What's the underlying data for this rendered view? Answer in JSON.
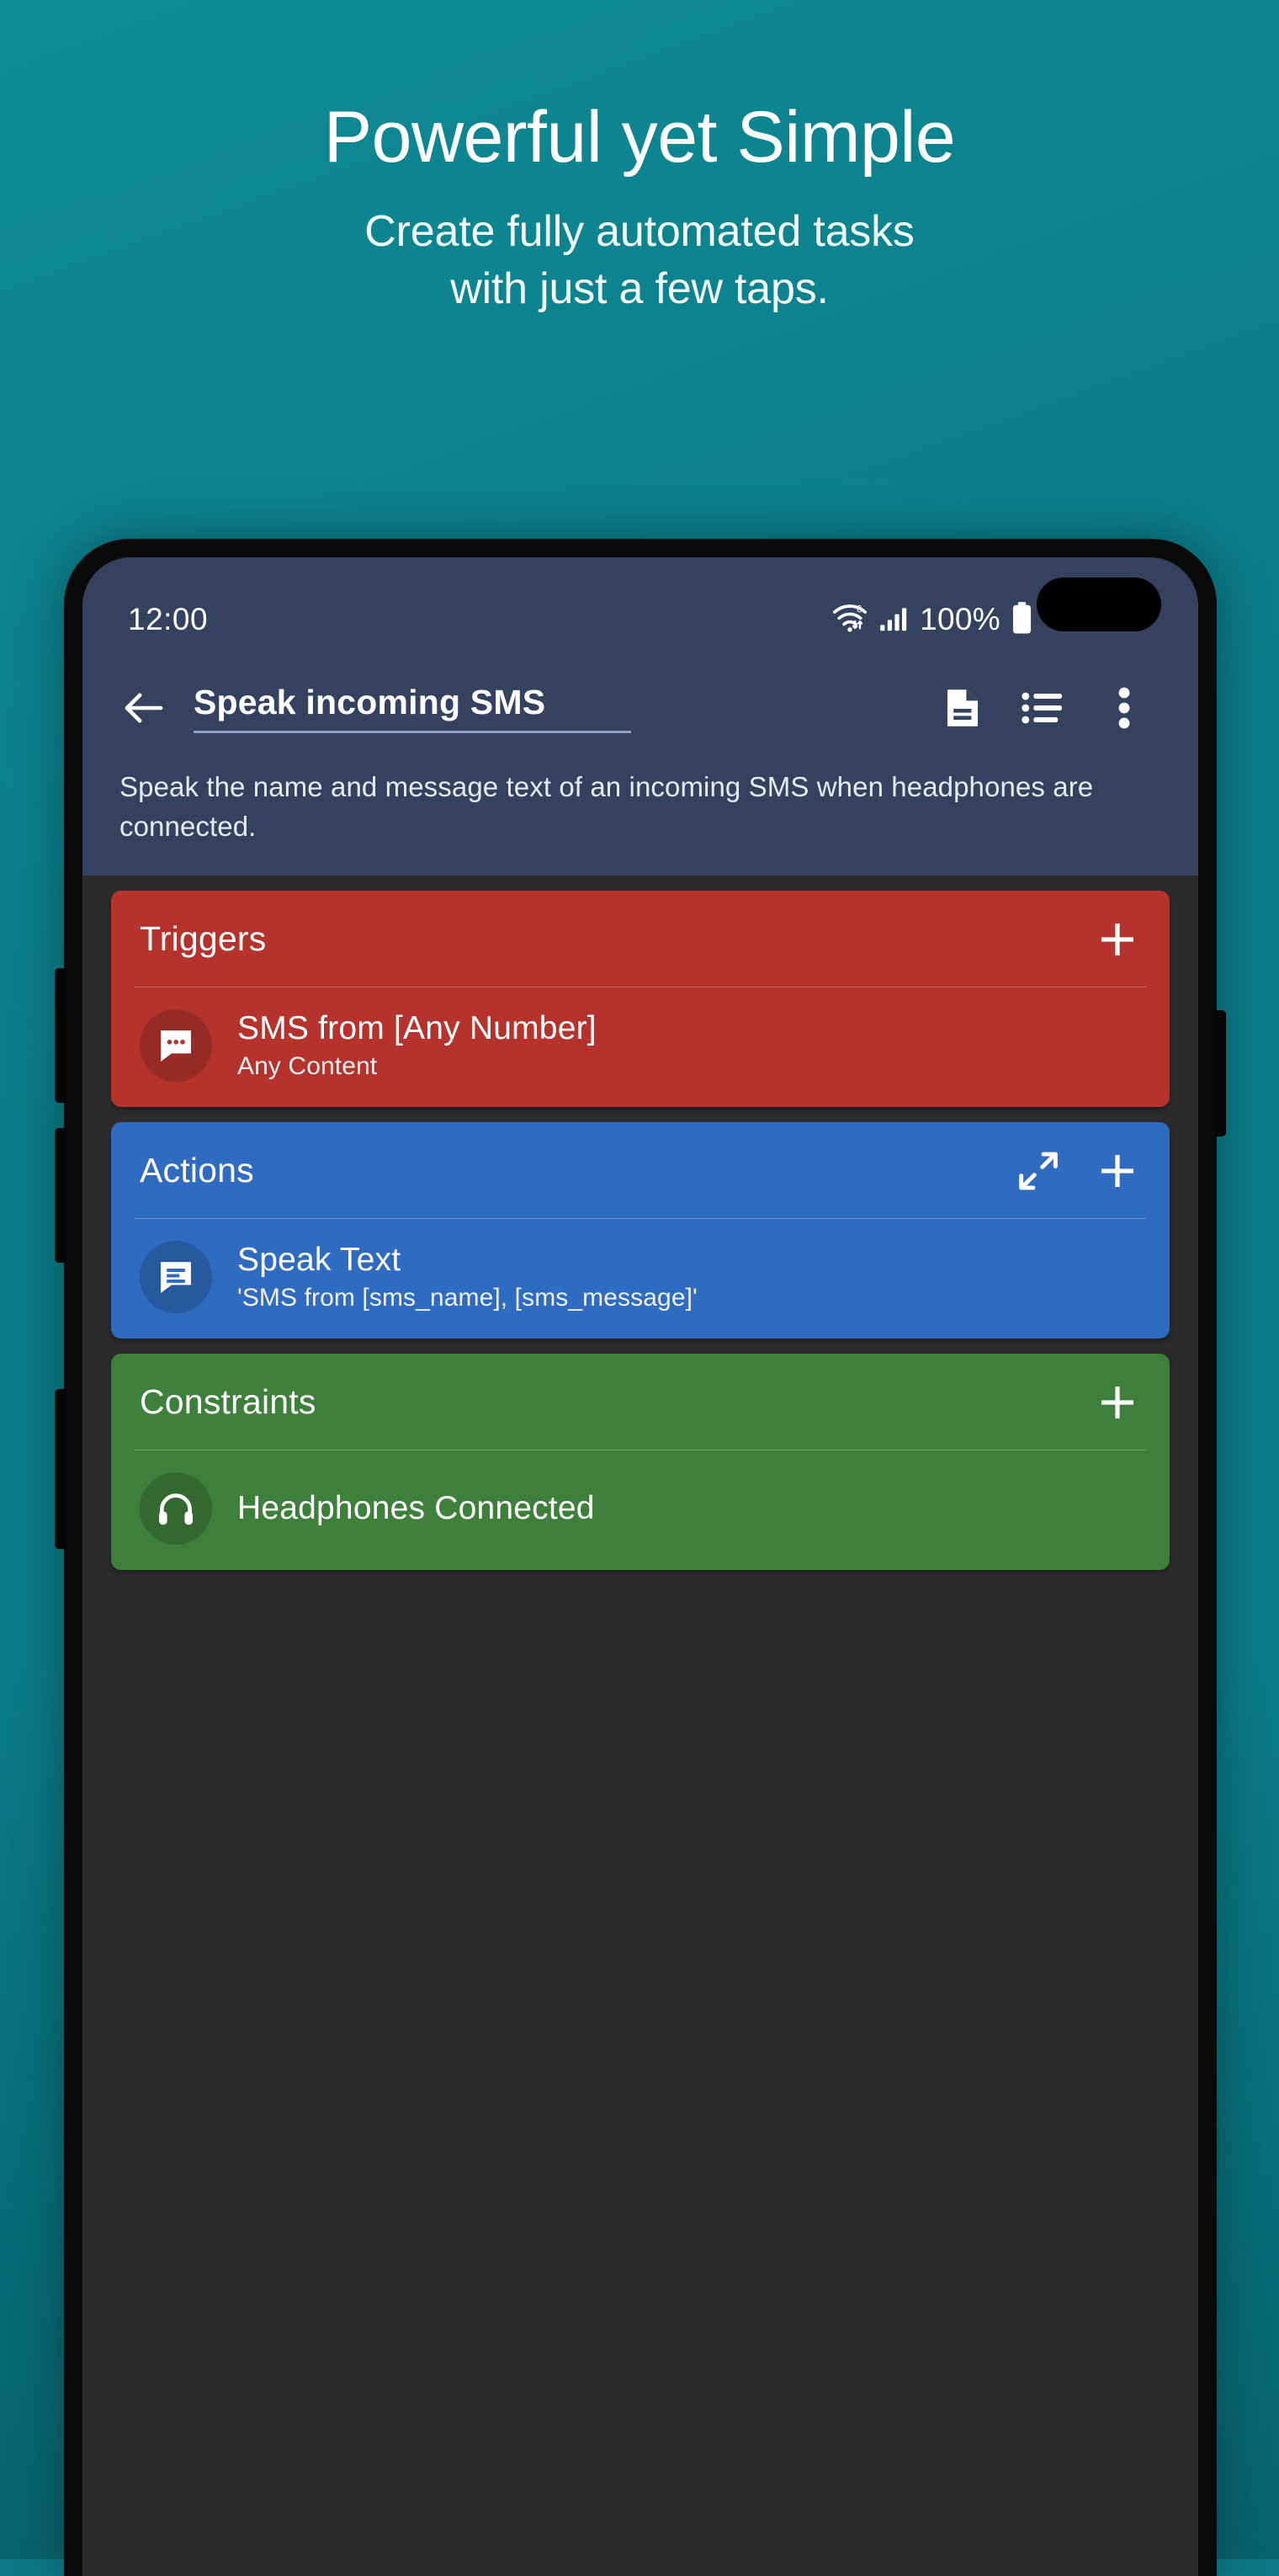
{
  "hero": {
    "headline": "Powerful yet Simple",
    "subline_1": "Create fully automated tasks",
    "subline_2": "with just a few taps."
  },
  "colors": {
    "background": "#0a7c88",
    "appbar": "#344260",
    "screen_bg": "#2c2c2e",
    "triggers": "#b5332c",
    "actions": "#2f6bc0",
    "constraints": "#3e7f3c"
  },
  "phone": {
    "statusbar": {
      "clock": "12:00",
      "wifi_icon": "wifi-6-icon",
      "signal_icon": "cellular-signal-icon",
      "battery_percent": "100%",
      "battery_icon": "battery-full-icon",
      "camera_cutout": "front-camera-cutout"
    },
    "appbar": {
      "back_icon": "back-arrow-icon",
      "title": "Speak incoming SMS",
      "icons": [
        {
          "name": "document-icon"
        },
        {
          "name": "list-icon"
        },
        {
          "name": "overflow-menu-icon"
        }
      ]
    },
    "description": "Speak the name and message text of an incoming SMS when headphones are connected.",
    "sections": [
      {
        "key": "triggers",
        "title": "Triggers",
        "color": "#b5332c",
        "add_icon": "plus-icon",
        "expand_icon": null,
        "items": [
          {
            "icon": "sms-message-icon",
            "title": "SMS from [Any Number]",
            "subtitle": "Any Content"
          }
        ]
      },
      {
        "key": "actions",
        "title": "Actions",
        "color": "#2f6bc0",
        "add_icon": "plus-icon",
        "expand_icon": "expand-arrows-icon",
        "items": [
          {
            "icon": "speak-text-icon",
            "title": "Speak Text",
            "subtitle": "'SMS from [sms_name], [sms_message]'"
          }
        ]
      },
      {
        "key": "constraints",
        "title": "Constraints",
        "color": "#3e7f3c",
        "add_icon": "plus-icon",
        "expand_icon": null,
        "items": [
          {
            "icon": "headphones-icon",
            "title": "Headphones Connected",
            "subtitle": ""
          }
        ]
      }
    ]
  }
}
